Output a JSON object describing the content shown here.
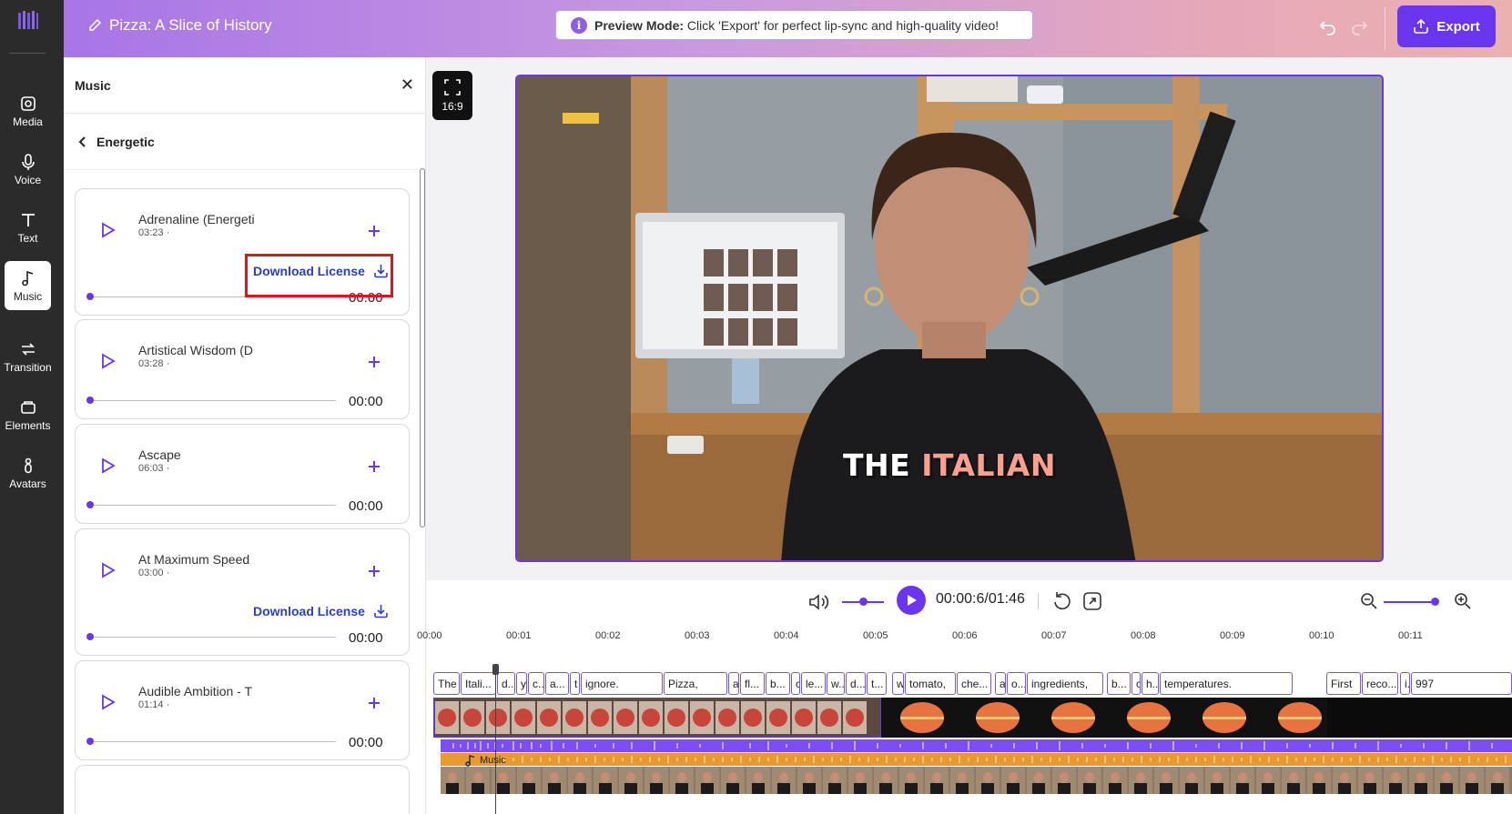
{
  "app": {
    "project_title": "Pizza: A Slice of History",
    "preview_label": "Preview Mode:",
    "preview_text": " Click 'Export' for perfect lip-sync and high-quality video!",
    "export_label": "Export"
  },
  "rail": {
    "items": [
      {
        "label": "Media",
        "icon": "media-icon"
      },
      {
        "label": "Voice",
        "icon": "microphone-icon"
      },
      {
        "label": "Text",
        "icon": "text-icon"
      },
      {
        "label": "Music",
        "icon": "music-note-icon",
        "active": true
      },
      {
        "label": "Transition",
        "icon": "transition-icon"
      },
      {
        "label": "Elements",
        "icon": "elements-icon"
      },
      {
        "label": "Avatars",
        "icon": "avatar-icon"
      }
    ]
  },
  "panel": {
    "title": "Music",
    "category": "Energetic",
    "download_license_label": "Download License",
    "tracks": [
      {
        "name": "Adrenaline (Energeti",
        "duration": "03:23 ·",
        "time": "00:00",
        "license": true
      },
      {
        "name": "Artistical Wisdom (D",
        "duration": "03:28 ·",
        "time": "00:00",
        "license": false
      },
      {
        "name": "Ascape",
        "duration": "06:03 ·",
        "time": "00:00",
        "license": false
      },
      {
        "name": "At Maximum Speed",
        "duration": "03:00 ·",
        "time": "00:00",
        "license": true
      },
      {
        "name": "Audible Ambition - T",
        "duration": "01:14 ·",
        "time": "00:00",
        "license": false
      }
    ]
  },
  "preview": {
    "aspect_ratio": "16:9",
    "caption_word_1": "THE",
    "caption_word_2": "ITALIAN"
  },
  "controls": {
    "timecode": "00:00:6/01:46",
    "volume_level": 0.6,
    "zoom_level": 0.88
  },
  "timeline": {
    "ticks": [
      "00:00",
      "00:01",
      "00:02",
      "00:03",
      "00:04",
      "00:05",
      "00:06",
      "00:07",
      "00:08",
      "00:09",
      "00:10",
      "00:11"
    ],
    "words": [
      "The",
      "Itali...",
      "d...",
      "y",
      "c...",
      "a...",
      "t",
      "ignore.",
      "Pizza,",
      "a",
      "fl...",
      "b...",
      "c",
      "le...",
      "w...",
      "d...",
      "t...",
      "w",
      "tomato,",
      "che...",
      "a",
      "o...",
      "ingredients,",
      "b...",
      "c",
      "h...",
      "temperatures.",
      "First",
      "reco...",
      "i.",
      "997"
    ],
    "music_track_label": "Music"
  },
  "colors": {
    "accent": "#6a35ef",
    "highlight_box": "#e0141e",
    "license_link": "#2a3ed0",
    "caption_highlight": "#f9a18e"
  }
}
